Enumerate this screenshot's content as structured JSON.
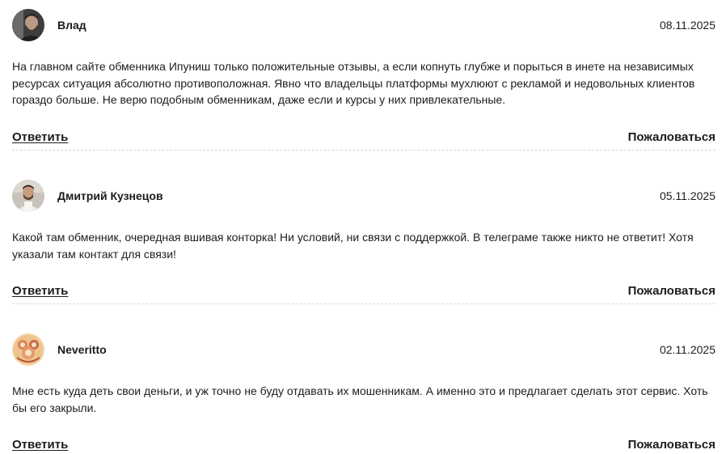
{
  "reviews": [
    {
      "author": "Влад",
      "date": "08.11.2025",
      "text": "На главном сайте обменника Ипуниш только положительные отзывы, а если копнуть глубже и порыться в инете на независимых ресурсах ситуация абсолютно противоположная. Явно что владельцы платформы мухлюют с рекламой и недовольных клиентов гораздо больше. Не верю подобным обменникам, даже если и курсы у них привлекательные.",
      "reply_label": "Ответить",
      "report_label": "Пожаловаться"
    },
    {
      "author": "Дмитрий Кузнецов",
      "date": "05.11.2025",
      "text": "Какой там обменник, очередная вшивая конторка! Ни условий, ни связи с поддержкой. В телеграме также никто не ответит! Хотя указали там контакт для связи!",
      "reply_label": "Ответить",
      "report_label": "Пожаловаться"
    },
    {
      "author": "Neveritto",
      "date": "02.11.2025",
      "text": "Мне есть куда деть свои деньги, и уж точно не буду отдавать их мошенникам. А именно это и предлагает сделать этот сервис. Хоть бы его закрыли.",
      "reply_label": "Ответить",
      "report_label": "Пожаловаться"
    }
  ]
}
